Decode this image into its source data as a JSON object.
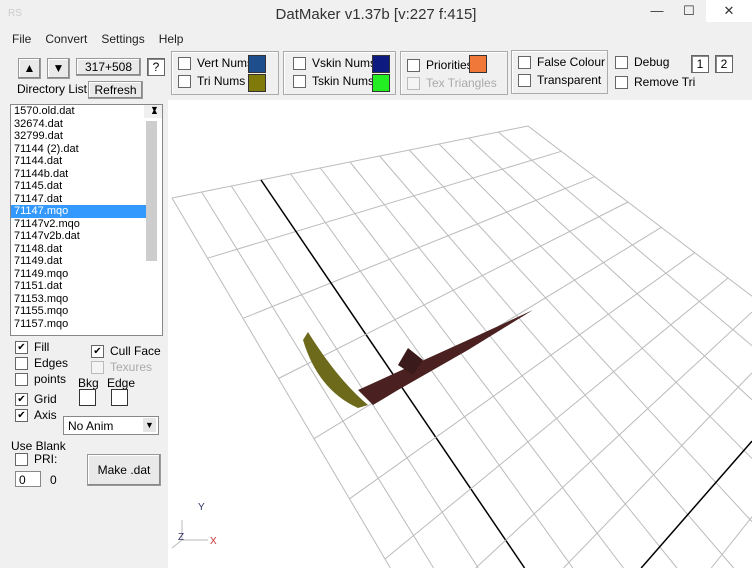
{
  "window": {
    "title": "DatMaker v1.37b  [v:227 f:415]",
    "app_icon": "RS",
    "minimize": "—",
    "maximize": "☐",
    "close": "✕"
  },
  "menu": [
    "File",
    "Convert",
    "Settings",
    "Help"
  ],
  "toolbar": {
    "up": "▲",
    "down": "▼",
    "size_label": "317+508",
    "help": "?",
    "dir_label": "Directory List",
    "refresh": "Refresh"
  },
  "options": {
    "vert_nums": "Vert Nums",
    "tri_nums": "Tri Nums",
    "vskin_nums": "Vskin Nums",
    "tskin_nums": "Tskin Nums",
    "priorities": "Priorities",
    "tex_triangles": "Tex Triangles",
    "false_colour": "False Colour",
    "transparent": "Transparent",
    "debug": "Debug",
    "remove_tri": "Remove Tri",
    "box1": "1",
    "box2": "2",
    "colors": {
      "vert": "#1f4e8c",
      "tri": "#7f7a0a",
      "vskin": "#0d1a80",
      "tskin": "#22ee22",
      "priorities": "#f07838"
    }
  },
  "files": [
    "1570.old.dat",
    "32674.dat",
    "32799.dat",
    "71144 (2).dat",
    "71144.dat",
    "71144b.dat",
    "71145.dat",
    "71147.dat",
    "71147.mqo",
    "71147v2.mqo",
    "71147v2b.dat",
    "71148.dat",
    "71149.dat",
    "71149.mqo",
    "71151.dat",
    "71153.mqo",
    "71155.mqo",
    "71157.mqo"
  ],
  "selected_file": "71147.mqo",
  "render": {
    "fill": "Fill",
    "edges": "Edges",
    "points": "points",
    "grid": "Grid",
    "axis": "Axis",
    "cull_face": "Cull Face",
    "texures": "Texures",
    "bkg": "Bkg",
    "edge": "Edge",
    "anim": "No Anim",
    "use_blank": "Use Blank",
    "pri": "PRI:",
    "pri_value": "0",
    "pri_count": "0",
    "make_dat": "Make .dat"
  },
  "axes": {
    "x": "X",
    "y": "Y",
    "z": "Z"
  }
}
